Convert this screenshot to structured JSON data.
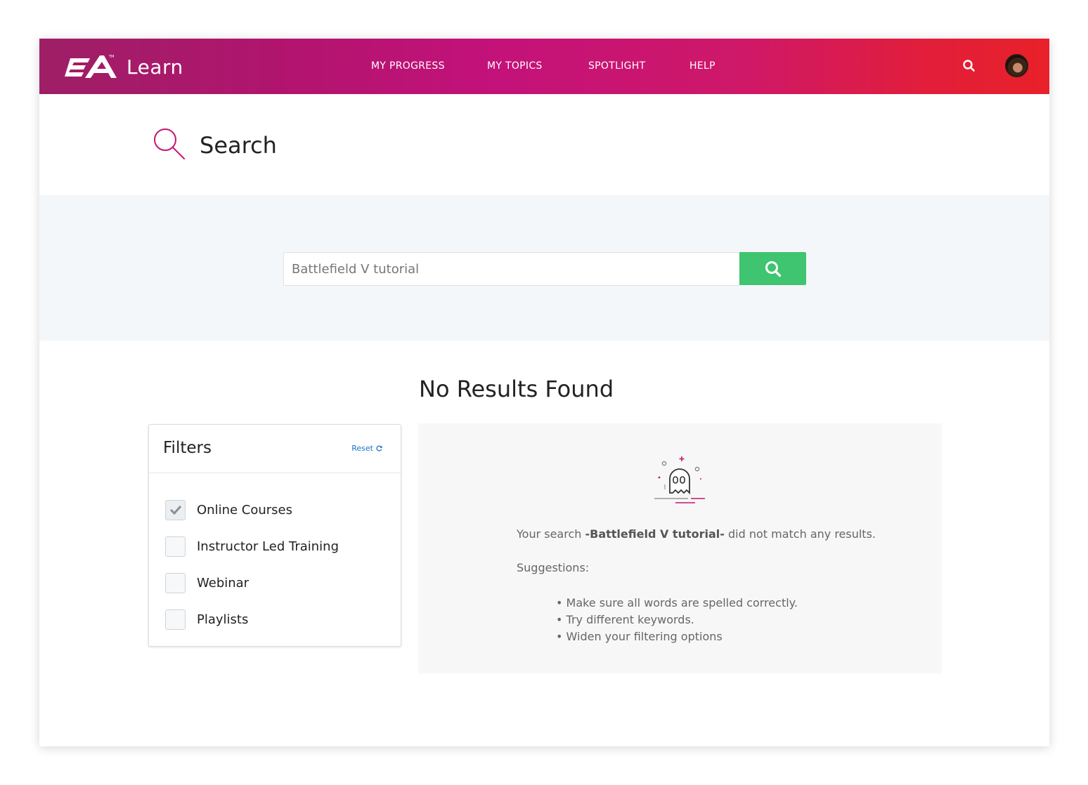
{
  "header": {
    "brand_mark": "EA",
    "brand_name": "Learn",
    "nav": [
      "MY PROGRESS",
      "MY TOPICS",
      "SPOTLIGHT",
      "HELP"
    ],
    "search_icon": "search-icon",
    "avatar": "user-avatar"
  },
  "page": {
    "title": "Search",
    "title_icon": "magnifier-icon"
  },
  "search": {
    "value": "Battlefield V tutorial",
    "button_icon": "search-icon"
  },
  "results": {
    "heading": "No Results Found",
    "message_prefix": "Your search ",
    "message_query": "-Battlefield V tutorial-",
    "message_suffix": " did not match any results.",
    "suggestions_title": "Suggestions:",
    "suggestions": [
      "• Make sure all words are spelled correctly.",
      "• Try different keywords.",
      "• Widen your filtering options"
    ],
    "illustration": "ghost-icon"
  },
  "filters": {
    "title": "Filters",
    "reset_label": "Reset",
    "items": [
      {
        "label": "Online Courses",
        "checked": true
      },
      {
        "label": "Instructor Led Training",
        "checked": false
      },
      {
        "label": "Webinar",
        "checked": false
      },
      {
        "label": "Playlists",
        "checked": false
      }
    ]
  },
  "colors": {
    "header_gradient_start": "#9e1f66",
    "header_gradient_mid": "#c3127a",
    "header_gradient_end": "#e82129",
    "search_button": "#3fc470",
    "accent_pink": "#c4166f",
    "link_blue": "#1a73c9"
  }
}
